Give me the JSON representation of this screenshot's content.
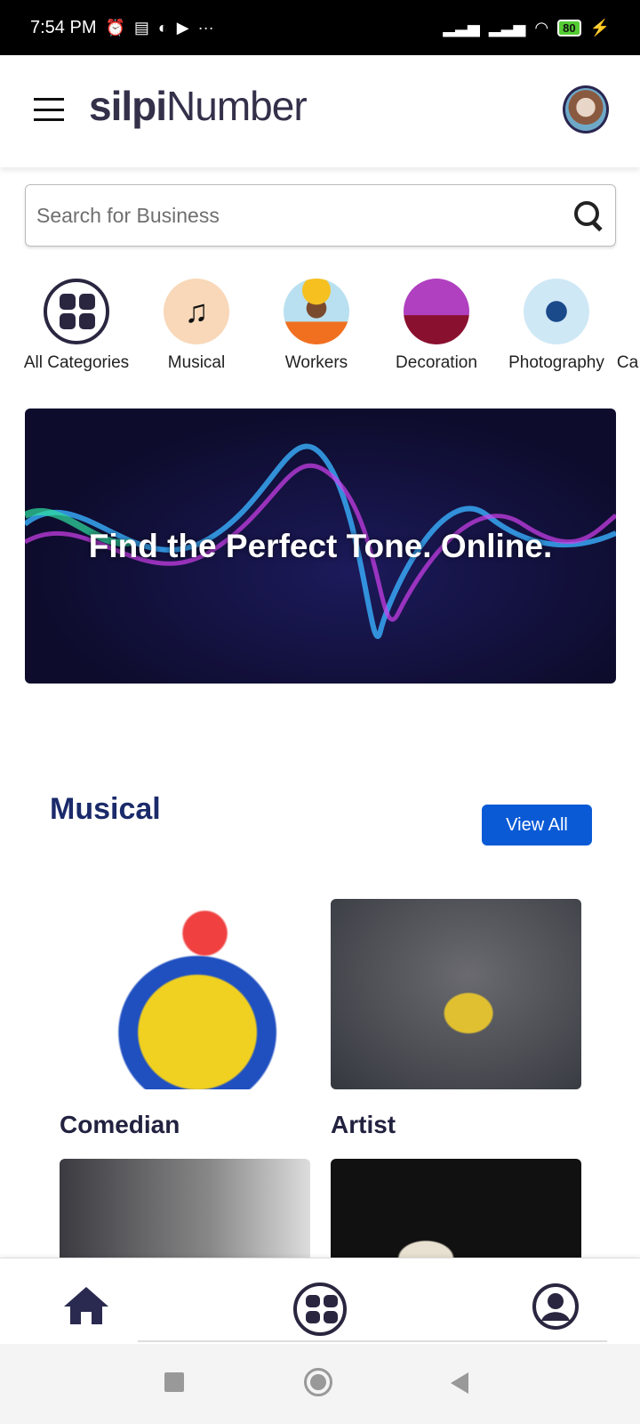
{
  "status_bar": {
    "time": "7:54 PM",
    "more": "···",
    "battery": "80"
  },
  "header": {
    "logo_bold": "silpi",
    "logo_light": "Number"
  },
  "search": {
    "placeholder": "Search for Business"
  },
  "categories": [
    {
      "label": "All Categories"
    },
    {
      "label": "Musical"
    },
    {
      "label": "Workers"
    },
    {
      "label": "Decoration"
    },
    {
      "label": "Photography"
    },
    {
      "label": "Ca"
    }
  ],
  "banner": {
    "text": "Find the Perfect Tone. Online."
  },
  "section": {
    "title": "Musical",
    "view_all": "View All",
    "items": [
      {
        "label": "Comedian"
      },
      {
        "label": "Artist"
      }
    ]
  },
  "colors": {
    "accent": "#0a5ad6",
    "title": "#1a2a6a"
  }
}
